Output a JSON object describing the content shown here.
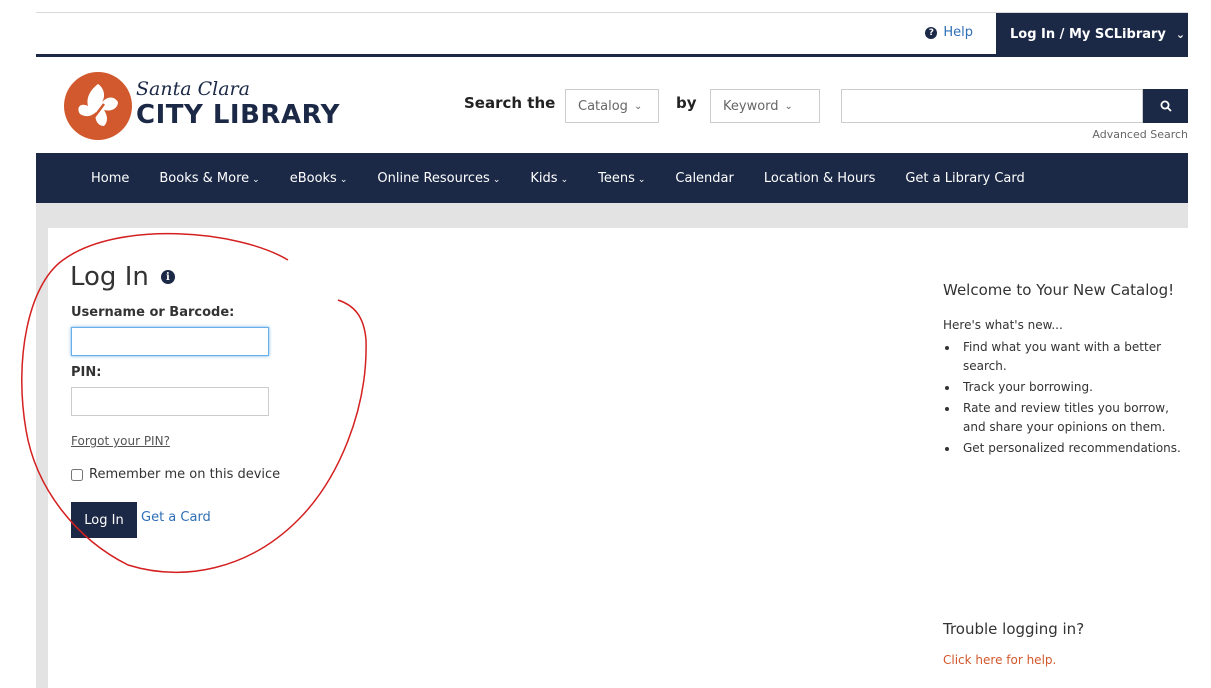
{
  "topbar": {
    "help_label": "Help",
    "account_label": "Log In / My SCLibrary"
  },
  "logo": {
    "script_text": "Santa Clara",
    "main_text": "CITY LIBRARY"
  },
  "search": {
    "search_the_label": "Search the",
    "scope_selected": "Catalog",
    "by_label": "by",
    "field_selected": "Keyword",
    "query_value": "",
    "advanced_label": "Advanced Search"
  },
  "nav": {
    "items": [
      {
        "label": "Home",
        "has_dropdown": false
      },
      {
        "label": "Books & More",
        "has_dropdown": true
      },
      {
        "label": "eBooks",
        "has_dropdown": true
      },
      {
        "label": "Online Resources",
        "has_dropdown": true
      },
      {
        "label": "Kids",
        "has_dropdown": true
      },
      {
        "label": "Teens",
        "has_dropdown": true
      },
      {
        "label": "Calendar",
        "has_dropdown": false
      },
      {
        "label": "Location & Hours",
        "has_dropdown": false
      },
      {
        "label": "Get a Library Card",
        "has_dropdown": false
      }
    ]
  },
  "login": {
    "title": "Log In",
    "username_label": "Username or Barcode:",
    "username_value": "",
    "pin_label": "PIN:",
    "pin_value": "",
    "forgot_label": "Forgot your PIN?",
    "remember_label": "Remember me on this device",
    "remember_checked": false,
    "submit_label": "Log In",
    "get_card_label": "Get a Card"
  },
  "sidebar": {
    "welcome_title": "Welcome to Your New Catalog!",
    "new_lead": "Here's what's new...",
    "features": [
      "Find what you want with a better search.",
      "Track your borrowing.",
      "Rate and review titles you borrow, and share your opinions on them.",
      "Get personalized recommendations."
    ],
    "trouble_title": "Trouble logging in?",
    "trouble_link": "Click here for help."
  },
  "colors": {
    "navy": "#1b2947",
    "brand_orange": "#d2582d",
    "link_blue": "#2f6fb5",
    "annotation_red": "#d42020"
  },
  "icons": {
    "help": "question-circle-icon",
    "account_chevron": "chevron-down-icon",
    "search": "magnifier-icon",
    "info": "info-circle-icon",
    "logo": "leaf-logo-icon"
  }
}
